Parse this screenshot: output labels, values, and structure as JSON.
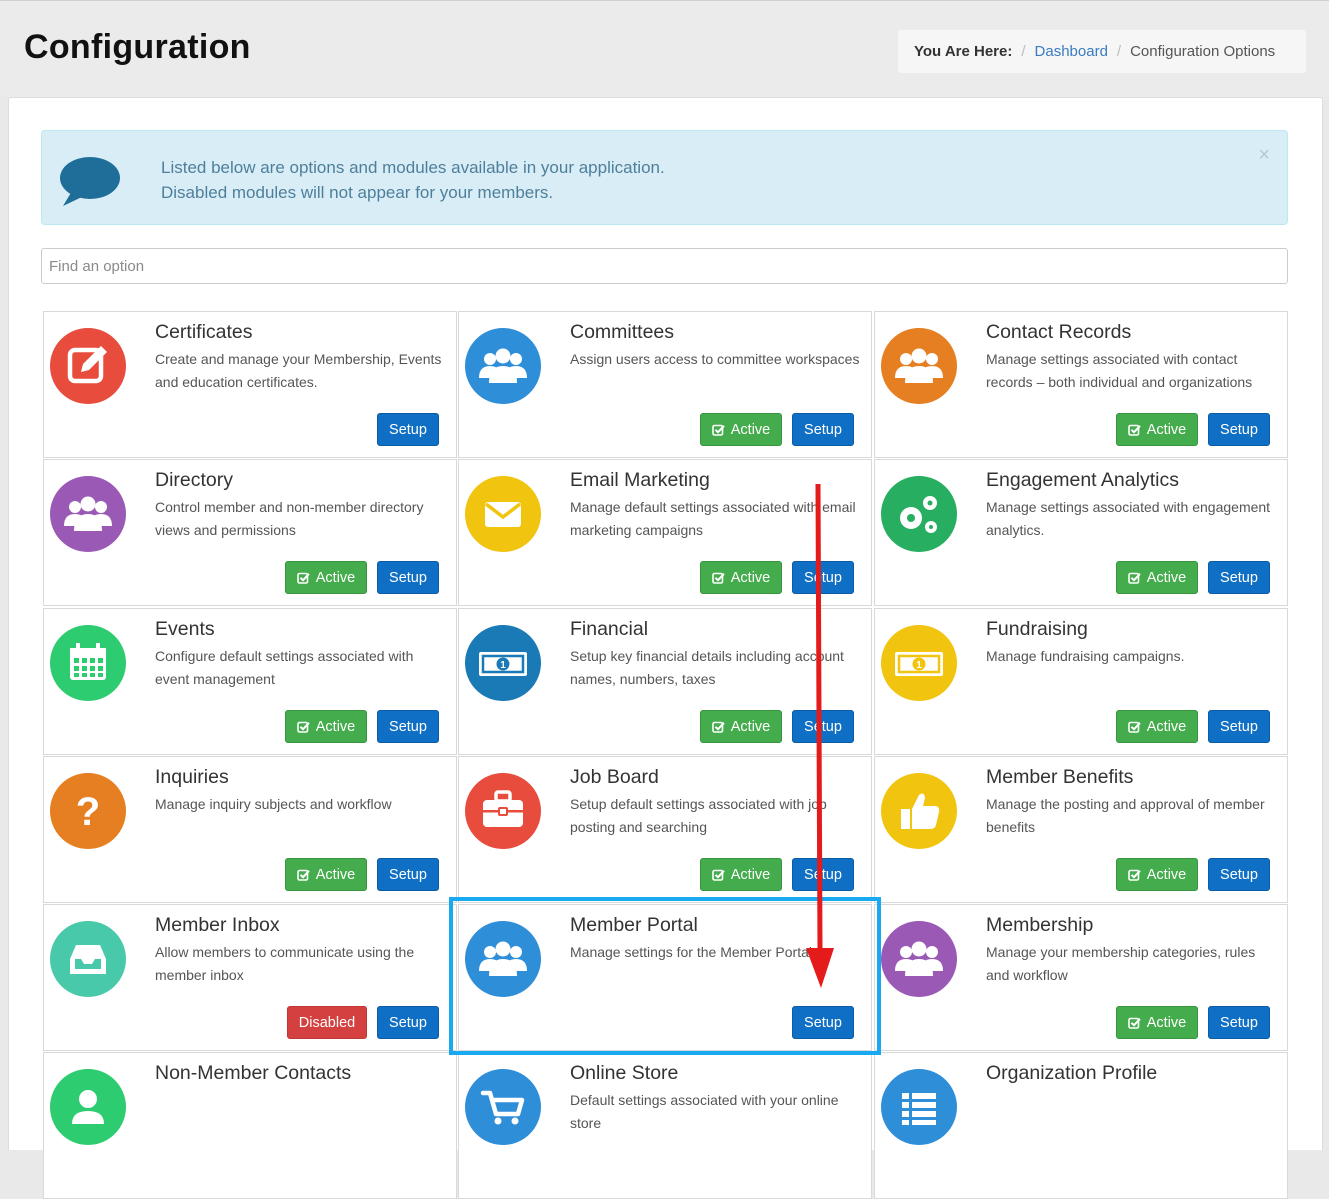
{
  "header": {
    "title": "Configuration",
    "breadcrumb": {
      "lead": "You Are Here:",
      "items": [
        "Dashboard",
        "Configuration Options"
      ]
    }
  },
  "alert": {
    "line1": "Listed below are options and modules available in your application.",
    "line2": "Disabled modules will not appear for your members.",
    "close": "×",
    "icon": "speech-bubble-icon"
  },
  "search": {
    "placeholder": "Find an option",
    "value": ""
  },
  "button_labels": {
    "setup": "Setup",
    "active": "Active",
    "disabled": "Disabled"
  },
  "colors": {
    "setup": "#0f6fc5",
    "active": "#44ac4c",
    "disabled": "#d4403f",
    "highlight": "#19a8f2",
    "arrow": "#e51a1a"
  },
  "modules": [
    {
      "title": "Certificates",
      "desc": "Create and manage your Membership, Events and education certificates.",
      "status": "",
      "icon": "certificate-edit-icon",
      "color": "#e74c3c"
    },
    {
      "title": "Committees",
      "desc": "Assign users access to committee workspaces",
      "status": "active",
      "icon": "group-icon",
      "color": "#2f8ed8"
    },
    {
      "title": "Contact Records",
      "desc": "Manage settings associated with contact records – both individual and organizations",
      "status": "active",
      "icon": "group-icon",
      "color": "#e67e22"
    },
    {
      "title": "Directory",
      "desc": "Control member and non-member directory views and permissions",
      "status": "active",
      "icon": "group-icon",
      "color": "#9b59b6"
    },
    {
      "title": "Email Marketing",
      "desc": "Manage default settings associated with email marketing campaigns",
      "status": "active",
      "icon": "envelope-icon",
      "color": "#f1c40f"
    },
    {
      "title": "Engagement Analytics",
      "desc": "Manage settings associated with engagement analytics.",
      "status": "active",
      "icon": "gears-icon",
      "color": "#27ae60"
    },
    {
      "title": "Events",
      "desc": "Configure default settings associated with event management",
      "status": "active",
      "icon": "calendar-icon",
      "color": "#2ecc71"
    },
    {
      "title": "Financial",
      "desc": "Setup key financial details including account names, numbers, taxes",
      "status": "active",
      "icon": "money-icon",
      "color": "#1a7ab5"
    },
    {
      "title": "Fundraising",
      "desc": "Manage fundraising campaigns.",
      "status": "active",
      "icon": "money-icon",
      "color": "#f1c40f"
    },
    {
      "title": "Inquiries",
      "desc": "Manage inquiry subjects and workflow",
      "status": "active",
      "icon": "question-icon",
      "color": "#e67e22"
    },
    {
      "title": "Job Board",
      "desc": "Setup default settings associated with job posting and searching",
      "status": "active",
      "icon": "briefcase-icon",
      "color": "#e74c3c"
    },
    {
      "title": "Member Benefits",
      "desc": "Manage the posting and approval of member benefits",
      "status": "active",
      "icon": "thumbs-up-icon",
      "color": "#f1c40f"
    },
    {
      "title": "Member Inbox",
      "desc": "Allow members to communicate using the member inbox",
      "status": "disabled",
      "icon": "inbox-icon",
      "color": "#48c9a9"
    },
    {
      "title": "Member Portal",
      "desc": "Manage settings for the Member Portal",
      "status": "",
      "icon": "group-icon",
      "color": "#2f8ed8"
    },
    {
      "title": "Membership",
      "desc": "Manage your membership categories, rules and workflow",
      "status": "active",
      "icon": "group-icon",
      "color": "#9b59b6"
    },
    {
      "title": "Non-Member Contacts",
      "desc": "",
      "status": "",
      "icon": "user-icon",
      "color": "#2ecc71"
    },
    {
      "title": "Online Store",
      "desc": "Default settings associated with your online store",
      "status": "",
      "icon": "cart-icon",
      "color": "#2f8ed8"
    },
    {
      "title": "Organization Profile",
      "desc": "",
      "status": "",
      "icon": "list-icon",
      "color": "#2f8ed8"
    }
  ]
}
